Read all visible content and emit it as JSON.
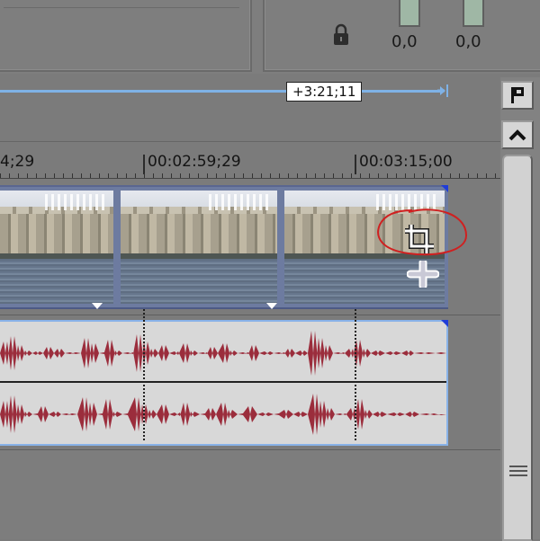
{
  "meters": {
    "left_value": "0,0",
    "right_value": "0,0"
  },
  "loop_region": {
    "length_label": "+3:21;11"
  },
  "ruler": {
    "label_left": "4;29",
    "label_mid": "00:02:59;29",
    "label_right": "00:03:15;00"
  },
  "icons": {
    "lock": "lock-icon",
    "event_crop": "crop-icon",
    "event_pan": "pan-crop-icon",
    "marker": "marker-flag-icon",
    "scroll_up": "chevron-up-icon",
    "scroll_grip": "grip-lines-icon"
  },
  "colors": {
    "loop_bar": "#7fb2e6",
    "audio_waveform": "#9b2d3c",
    "audio_selection": "#88b2e8",
    "video_event": "#6d7ba0",
    "annotation": "#d02020"
  }
}
